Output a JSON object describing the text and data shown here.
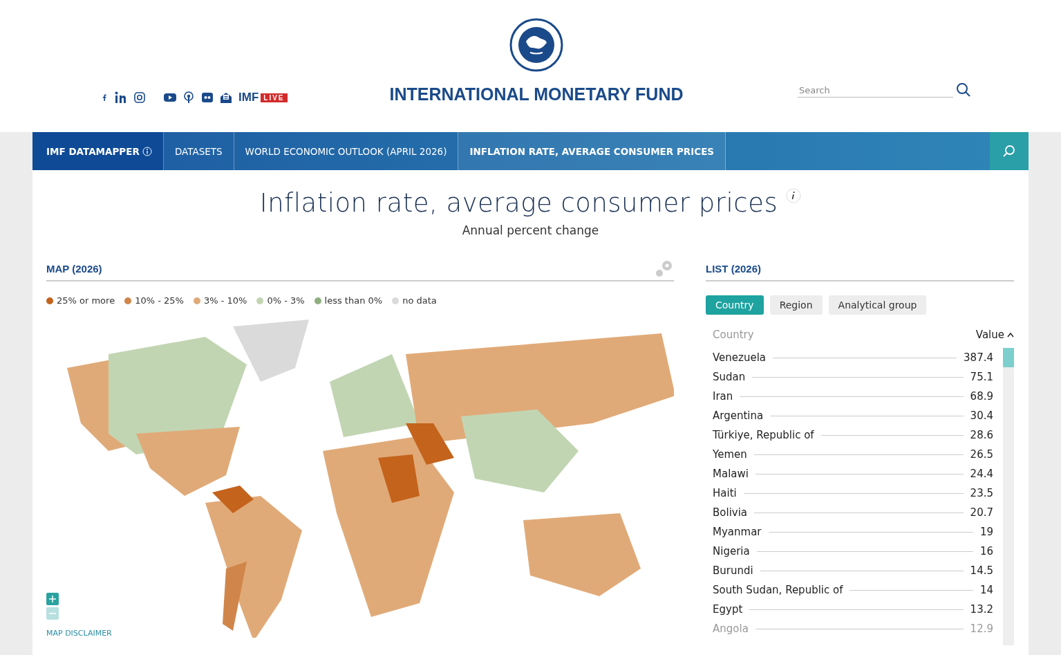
{
  "header": {
    "social": [
      {
        "kind": "facebook"
      },
      {
        "kind": "linkedin"
      },
      {
        "kind": "instagram"
      },
      {
        "kind": "youtube"
      },
      {
        "kind": "podcast"
      },
      {
        "kind": "flickr"
      },
      {
        "kind": "newsletter"
      }
    ],
    "live_brand": "IMF",
    "live_badge": "LIVE",
    "title": "INTERNATIONAL MONETARY FUND",
    "search": {
      "placeholder": "Search"
    }
  },
  "nav": [
    {
      "label": "IMF DATAMAPPER",
      "kind": "brand",
      "selected": false
    },
    {
      "label": "DATASETS",
      "kind": "link",
      "selected": false
    },
    {
      "label": "WORLD ECONOMIC OUTLOOK (APRIL 2026)",
      "kind": "link",
      "selected": false
    },
    {
      "label": "INFLATION RATE, AVERAGE CONSUMER PRICES",
      "kind": "link",
      "selected": true
    }
  ],
  "page": {
    "title": "Inflation rate, average consumer prices",
    "subtitle": "Annual percent change"
  },
  "map": {
    "heading": "MAP (2026)",
    "legend": [
      {
        "label": "25% or more",
        "color": "#c4631c"
      },
      {
        "label": "10% - 25%",
        "color": "#d0864a"
      },
      {
        "label": "3% - 10%",
        "color": "#e0aa78"
      },
      {
        "label": "0% - 3%",
        "color": "#c2d5b3"
      },
      {
        "label": "less than 0%",
        "color": "#8fae80"
      },
      {
        "label": "no data",
        "color": "#dadada"
      }
    ],
    "zoom": [
      {
        "kind": "plus",
        "disabled": false
      },
      {
        "kind": "minus",
        "disabled": true
      }
    ],
    "disclaimer": "MAP DISCLAIMER"
  },
  "list": {
    "heading": "LIST (2026)",
    "tabs": [
      {
        "label": "Country",
        "selected": true
      },
      {
        "label": "Region",
        "selected": false
      },
      {
        "label": "Analytical group",
        "selected": false
      }
    ],
    "columns": [
      "Country",
      "Value"
    ],
    "rows": [
      {
        "name": "Venezuela",
        "value": "387.4",
        "faded": false
      },
      {
        "name": "Sudan",
        "value": "75.1",
        "faded": false
      },
      {
        "name": "Iran",
        "value": "68.9",
        "faded": false
      },
      {
        "name": "Argentina",
        "value": "30.4",
        "faded": false
      },
      {
        "name": "Türkiye, Republic of",
        "value": "28.6",
        "faded": false
      },
      {
        "name": "Yemen",
        "value": "26.5",
        "faded": false
      },
      {
        "name": "Malawi",
        "value": "24.4",
        "faded": false
      },
      {
        "name": "Haiti",
        "value": "23.5",
        "faded": false
      },
      {
        "name": "Bolivia",
        "value": "20.7",
        "faded": false
      },
      {
        "name": "Myanmar",
        "value": "19",
        "faded": false
      },
      {
        "name": "Nigeria",
        "value": "16",
        "faded": false
      },
      {
        "name": "Burundi",
        "value": "14.5",
        "faded": false
      },
      {
        "name": "South Sudan, Republic of",
        "value": "14",
        "faded": false
      },
      {
        "name": "Egypt",
        "value": "13.2",
        "faded": false
      },
      {
        "name": "Angola",
        "value": "12.9",
        "faded": true
      }
    ]
  }
}
